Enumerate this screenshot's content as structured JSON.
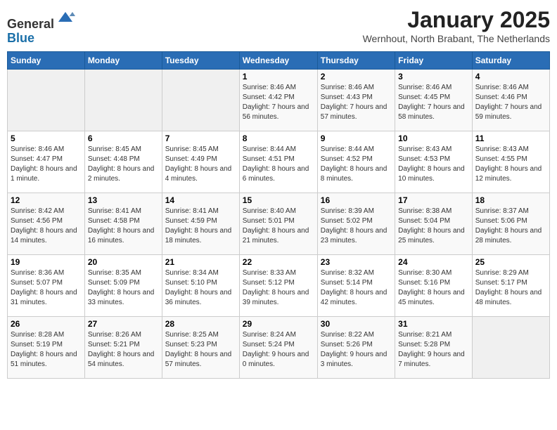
{
  "header": {
    "logo_line1": "General",
    "logo_line2": "Blue",
    "month_title": "January 2025",
    "location": "Wernhout, North Brabant, The Netherlands"
  },
  "weekdays": [
    "Sunday",
    "Monday",
    "Tuesday",
    "Wednesday",
    "Thursday",
    "Friday",
    "Saturday"
  ],
  "weeks": [
    [
      {
        "day": "",
        "sunrise": "",
        "sunset": "",
        "daylight": "",
        "empty": true
      },
      {
        "day": "",
        "sunrise": "",
        "sunset": "",
        "daylight": "",
        "empty": true
      },
      {
        "day": "",
        "sunrise": "",
        "sunset": "",
        "daylight": "",
        "empty": true
      },
      {
        "day": "1",
        "sunrise": "Sunrise: 8:46 AM",
        "sunset": "Sunset: 4:42 PM",
        "daylight": "Daylight: 7 hours and 56 minutes."
      },
      {
        "day": "2",
        "sunrise": "Sunrise: 8:46 AM",
        "sunset": "Sunset: 4:43 PM",
        "daylight": "Daylight: 7 hours and 57 minutes."
      },
      {
        "day": "3",
        "sunrise": "Sunrise: 8:46 AM",
        "sunset": "Sunset: 4:45 PM",
        "daylight": "Daylight: 7 hours and 58 minutes."
      },
      {
        "day": "4",
        "sunrise": "Sunrise: 8:46 AM",
        "sunset": "Sunset: 4:46 PM",
        "daylight": "Daylight: 7 hours and 59 minutes."
      }
    ],
    [
      {
        "day": "5",
        "sunrise": "Sunrise: 8:46 AM",
        "sunset": "Sunset: 4:47 PM",
        "daylight": "Daylight: 8 hours and 1 minute."
      },
      {
        "day": "6",
        "sunrise": "Sunrise: 8:45 AM",
        "sunset": "Sunset: 4:48 PM",
        "daylight": "Daylight: 8 hours and 2 minutes."
      },
      {
        "day": "7",
        "sunrise": "Sunrise: 8:45 AM",
        "sunset": "Sunset: 4:49 PM",
        "daylight": "Daylight: 8 hours and 4 minutes."
      },
      {
        "day": "8",
        "sunrise": "Sunrise: 8:44 AM",
        "sunset": "Sunset: 4:51 PM",
        "daylight": "Daylight: 8 hours and 6 minutes."
      },
      {
        "day": "9",
        "sunrise": "Sunrise: 8:44 AM",
        "sunset": "Sunset: 4:52 PM",
        "daylight": "Daylight: 8 hours and 8 minutes."
      },
      {
        "day": "10",
        "sunrise": "Sunrise: 8:43 AM",
        "sunset": "Sunset: 4:53 PM",
        "daylight": "Daylight: 8 hours and 10 minutes."
      },
      {
        "day": "11",
        "sunrise": "Sunrise: 8:43 AM",
        "sunset": "Sunset: 4:55 PM",
        "daylight": "Daylight: 8 hours and 12 minutes."
      }
    ],
    [
      {
        "day": "12",
        "sunrise": "Sunrise: 8:42 AM",
        "sunset": "Sunset: 4:56 PM",
        "daylight": "Daylight: 8 hours and 14 minutes."
      },
      {
        "day": "13",
        "sunrise": "Sunrise: 8:41 AM",
        "sunset": "Sunset: 4:58 PM",
        "daylight": "Daylight: 8 hours and 16 minutes."
      },
      {
        "day": "14",
        "sunrise": "Sunrise: 8:41 AM",
        "sunset": "Sunset: 4:59 PM",
        "daylight": "Daylight: 8 hours and 18 minutes."
      },
      {
        "day": "15",
        "sunrise": "Sunrise: 8:40 AM",
        "sunset": "Sunset: 5:01 PM",
        "daylight": "Daylight: 8 hours and 21 minutes."
      },
      {
        "day": "16",
        "sunrise": "Sunrise: 8:39 AM",
        "sunset": "Sunset: 5:02 PM",
        "daylight": "Daylight: 8 hours and 23 minutes."
      },
      {
        "day": "17",
        "sunrise": "Sunrise: 8:38 AM",
        "sunset": "Sunset: 5:04 PM",
        "daylight": "Daylight: 8 hours and 25 minutes."
      },
      {
        "day": "18",
        "sunrise": "Sunrise: 8:37 AM",
        "sunset": "Sunset: 5:06 PM",
        "daylight": "Daylight: 8 hours and 28 minutes."
      }
    ],
    [
      {
        "day": "19",
        "sunrise": "Sunrise: 8:36 AM",
        "sunset": "Sunset: 5:07 PM",
        "daylight": "Daylight: 8 hours and 31 minutes."
      },
      {
        "day": "20",
        "sunrise": "Sunrise: 8:35 AM",
        "sunset": "Sunset: 5:09 PM",
        "daylight": "Daylight: 8 hours and 33 minutes."
      },
      {
        "day": "21",
        "sunrise": "Sunrise: 8:34 AM",
        "sunset": "Sunset: 5:10 PM",
        "daylight": "Daylight: 8 hours and 36 minutes."
      },
      {
        "day": "22",
        "sunrise": "Sunrise: 8:33 AM",
        "sunset": "Sunset: 5:12 PM",
        "daylight": "Daylight: 8 hours and 39 minutes."
      },
      {
        "day": "23",
        "sunrise": "Sunrise: 8:32 AM",
        "sunset": "Sunset: 5:14 PM",
        "daylight": "Daylight: 8 hours and 42 minutes."
      },
      {
        "day": "24",
        "sunrise": "Sunrise: 8:30 AM",
        "sunset": "Sunset: 5:16 PM",
        "daylight": "Daylight: 8 hours and 45 minutes."
      },
      {
        "day": "25",
        "sunrise": "Sunrise: 8:29 AM",
        "sunset": "Sunset: 5:17 PM",
        "daylight": "Daylight: 8 hours and 48 minutes."
      }
    ],
    [
      {
        "day": "26",
        "sunrise": "Sunrise: 8:28 AM",
        "sunset": "Sunset: 5:19 PM",
        "daylight": "Daylight: 8 hours and 51 minutes."
      },
      {
        "day": "27",
        "sunrise": "Sunrise: 8:26 AM",
        "sunset": "Sunset: 5:21 PM",
        "daylight": "Daylight: 8 hours and 54 minutes."
      },
      {
        "day": "28",
        "sunrise": "Sunrise: 8:25 AM",
        "sunset": "Sunset: 5:23 PM",
        "daylight": "Daylight: 8 hours and 57 minutes."
      },
      {
        "day": "29",
        "sunrise": "Sunrise: 8:24 AM",
        "sunset": "Sunset: 5:24 PM",
        "daylight": "Daylight: 9 hours and 0 minutes."
      },
      {
        "day": "30",
        "sunrise": "Sunrise: 8:22 AM",
        "sunset": "Sunset: 5:26 PM",
        "daylight": "Daylight: 9 hours and 3 minutes."
      },
      {
        "day": "31",
        "sunrise": "Sunrise: 8:21 AM",
        "sunset": "Sunset: 5:28 PM",
        "daylight": "Daylight: 9 hours and 7 minutes."
      },
      {
        "day": "",
        "sunrise": "",
        "sunset": "",
        "daylight": "",
        "empty": true
      }
    ]
  ]
}
